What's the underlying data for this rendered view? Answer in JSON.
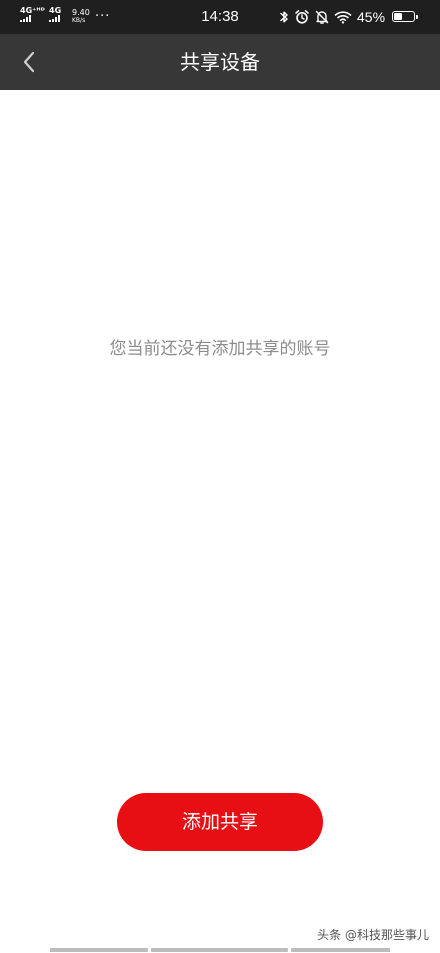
{
  "status_bar": {
    "sim1_network": "4G⁺ᴴᴰ",
    "sim2_network": "4G",
    "speed_value": "9.40",
    "speed_unit": "KB/s",
    "more_dots": "···",
    "time": "14:38",
    "battery_percent": "45%",
    "battery_level": 0.45,
    "icons": [
      "bluetooth-icon",
      "alarm-icon",
      "silent-bell-icon",
      "wifi-icon",
      "battery-icon"
    ]
  },
  "nav": {
    "title": "共享设备",
    "back_icon": "chevron-left-icon"
  },
  "main": {
    "empty_message": "您当前还没有添加共享的账号"
  },
  "action": {
    "add_share_label": "添加共享"
  },
  "watermark": {
    "text": "头条 @科技那些事儿"
  },
  "colors": {
    "status_bar_bg": "#1f1f1f",
    "nav_bar_bg": "#373737",
    "accent_red": "#e80f14",
    "empty_text": "#8c8c8c",
    "page_bg": "#ffffff"
  }
}
